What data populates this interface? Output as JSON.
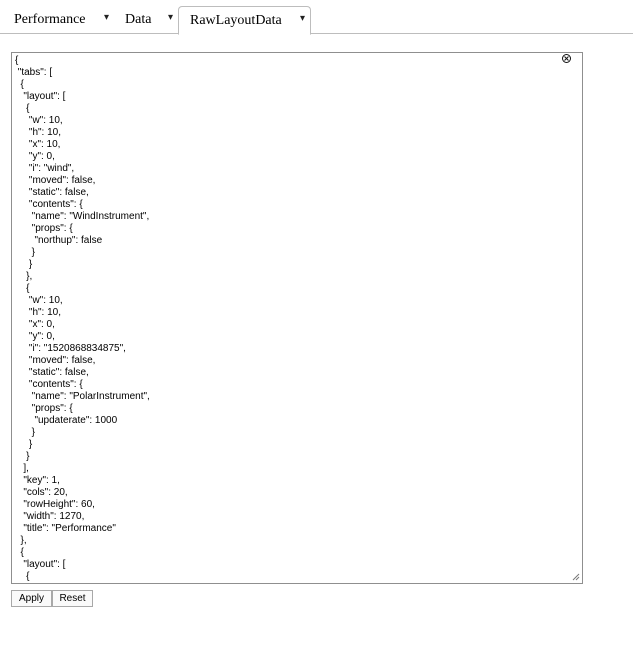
{
  "tabs": [
    {
      "label": "Performance",
      "caret": "▾"
    },
    {
      "label": "Data",
      "caret": "▾"
    },
    {
      "label": "RawLayoutData",
      "caret": "▾"
    }
  ],
  "editor": {
    "lines": [
      "{",
      " \"tabs\": [",
      "  {",
      "   \"layout\": [",
      "    {",
      "     \"w\": 10,",
      "     \"h\": 10,",
      "     \"x\": 10,",
      "     \"y\": 0,",
      "     \"i\": \"wind\",",
      "     \"moved\": false,",
      "     \"static\": false,",
      "     \"contents\": {",
      "      \"name\": \"WindInstrument\",",
      "      \"props\": {",
      "       \"northup\": false",
      "      }",
      "     }",
      "    },",
      "    {",
      "     \"w\": 10,",
      "     \"h\": 10,",
      "     \"x\": 0,",
      "     \"y\": 0,",
      "     \"i\": \"1520868834875\",",
      "     \"moved\": false,",
      "     \"static\": false,",
      "     \"contents\": {",
      "      \"name\": \"PolarInstrument\",",
      "      \"props\": {",
      "       \"updaterate\": 1000",
      "      }",
      "     }",
      "    }",
      "   ],",
      "   \"key\": 1,",
      "   \"cols\": 20,",
      "   \"rowHeight\": 60,",
      "   \"width\": 1270,",
      "   \"title\": \"Performance\"",
      "  },",
      "  {",
      "   \"layout\": [",
      "    {"
    ]
  },
  "buttons": {
    "apply": "Apply",
    "reset": "Reset"
  }
}
